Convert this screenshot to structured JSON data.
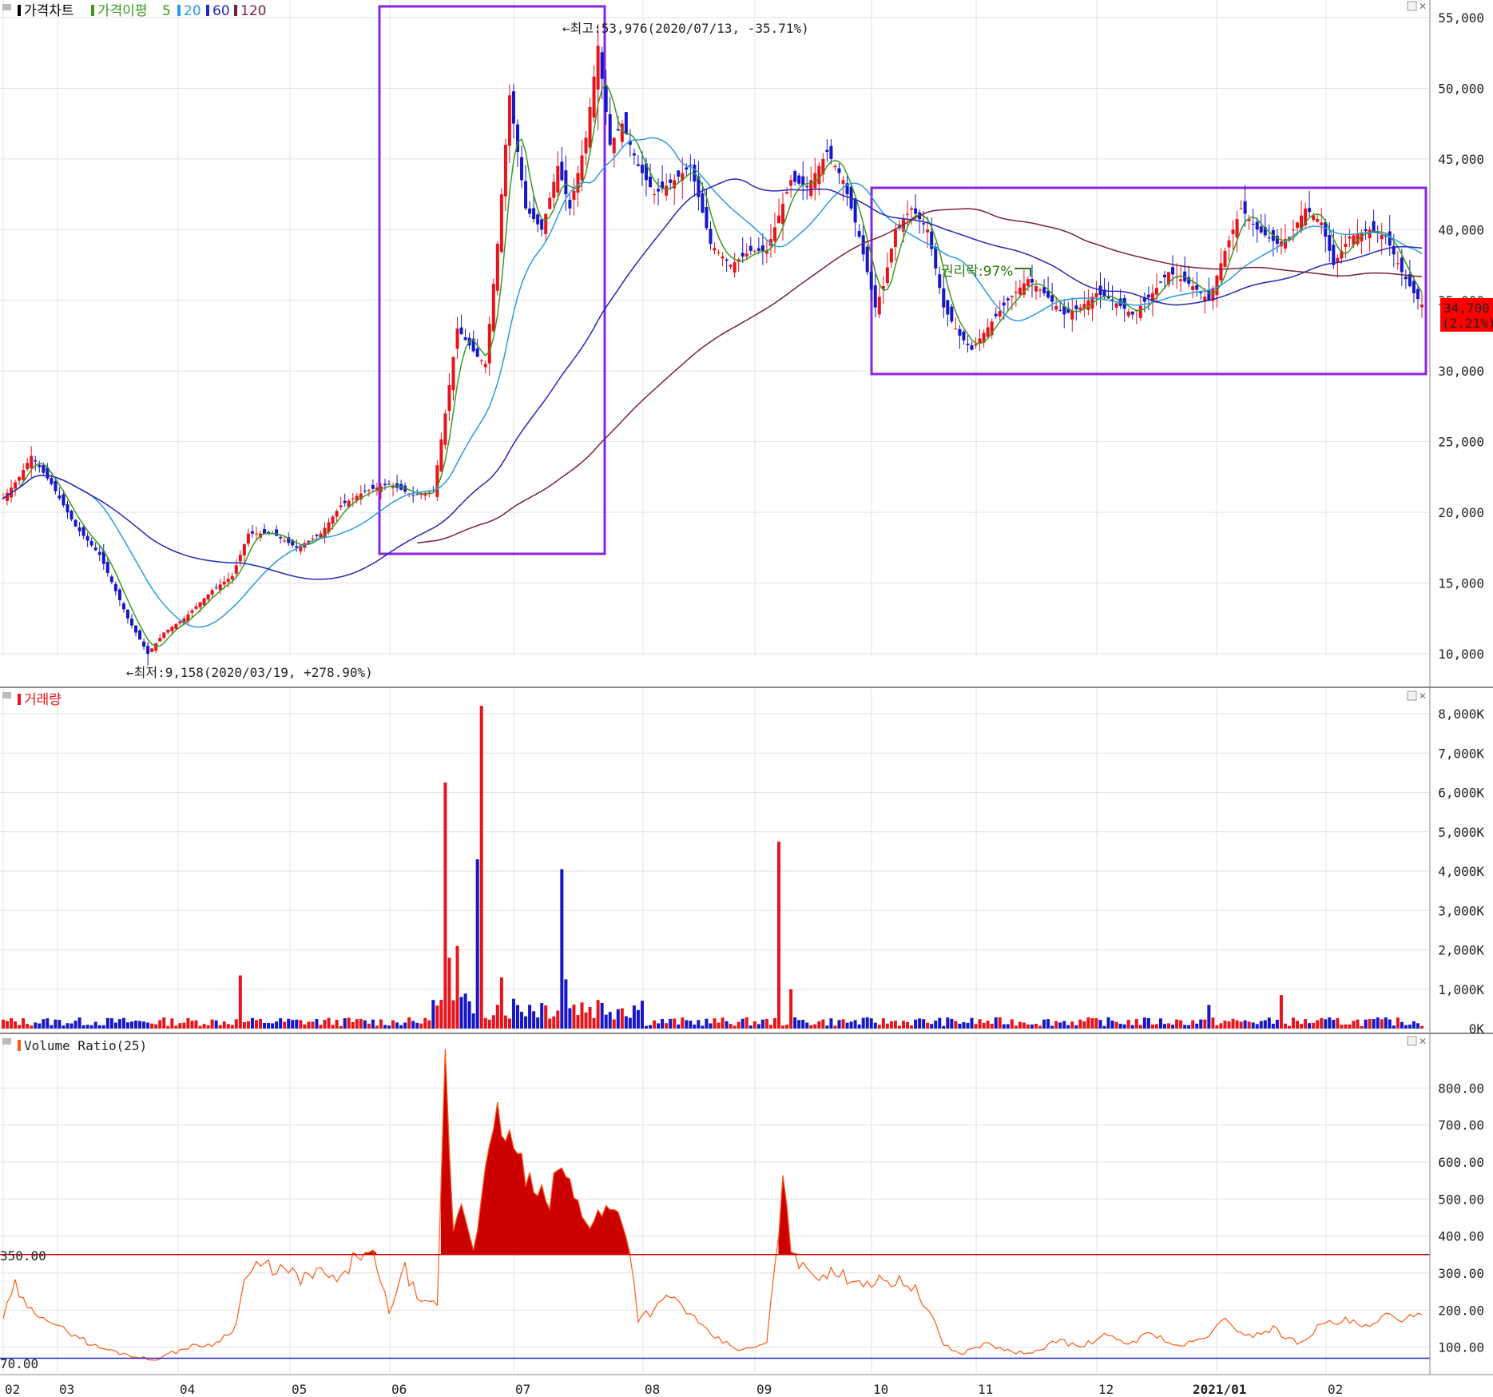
{
  "colors": {
    "up": "#e8141b",
    "down": "#1717c8",
    "ma5": "#3c9a1e",
    "ma20": "#2b9be0",
    "ma60": "#2626b8",
    "ma120": "#7a1f3c",
    "box": "#8a24e0",
    "ratio_line": "#ff5a14",
    "ratio_fill": "#cc0000",
    "label_box_bg": "#ff0000"
  },
  "price_panel": {
    "legend": [
      "가격차트",
      "가격이평",
      "5",
      "20",
      "60",
      "120"
    ],
    "y_ticks": [
      "55,000",
      "50,000",
      "45,000",
      "40,000",
      "35,000",
      "30,000",
      "25,000",
      "20,000",
      "15,000",
      "10,000"
    ],
    "high_annotation": "←최고:53,976(2020/07/13, -35.71%)",
    "low_annotation": "←최저:9,158(2020/03/19, +278.90%)",
    "ex_rights_annotation": "권리락:97%",
    "current_price": "34,700",
    "current_change": "(2.21%)"
  },
  "volume_panel": {
    "title": "거래량",
    "y_ticks": [
      "8,000K",
      "7,000K",
      "6,000K",
      "5,000K",
      "4,000K",
      "3,000K",
      "2,000K",
      "1,000K",
      "0K"
    ]
  },
  "ratio_panel": {
    "title": "Volume Ratio(25)",
    "y_ticks": [
      "800.00",
      "700.00",
      "600.00",
      "500.00",
      "400.00",
      "300.00",
      "200.00",
      "100.00"
    ],
    "upper_line_label": "350.00",
    "lower_line_label": "70.00"
  },
  "x_axis": {
    "labels": [
      "02",
      "03",
      "04",
      "05",
      "06",
      "07",
      "08",
      "09",
      "10",
      "11",
      "12",
      "2021/01",
      "02"
    ]
  },
  "chart_data": [
    {
      "type": "candlestick",
      "ylim": [
        8000,
        56000
      ],
      "moving_averages": [
        5,
        20,
        60,
        120
      ],
      "anchors": [
        [
          0,
          21000
        ],
        [
          4,
          22500
        ],
        [
          7,
          24000
        ],
        [
          12,
          22000
        ],
        [
          18,
          19000
        ],
        [
          24,
          17000
        ],
        [
          31,
          12500
        ],
        [
          36,
          10000
        ],
        [
          40,
          11500
        ],
        [
          45,
          12500
        ],
        [
          52,
          14500
        ],
        [
          57,
          15500
        ],
        [
          61,
          18500
        ],
        [
          67,
          18500
        ],
        [
          73,
          17500
        ],
        [
          79,
          18500
        ],
        [
          84,
          20500
        ],
        [
          90,
          21500
        ],
        [
          96,
          22000
        ],
        [
          102,
          21200
        ],
        [
          107,
          21500
        ],
        [
          110,
          27000
        ],
        [
          113,
          33000
        ],
        [
          118,
          31000
        ],
        [
          120,
          30500
        ],
        [
          123,
          39000
        ],
        [
          126,
          49500
        ],
        [
          130,
          41500
        ],
        [
          134,
          40000
        ],
        [
          138,
          44500
        ],
        [
          141,
          41500
        ],
        [
          145,
          46500
        ],
        [
          148,
          53000
        ],
        [
          151,
          46000
        ],
        [
          154,
          47500
        ],
        [
          158,
          44500
        ],
        [
          162,
          42500
        ],
        [
          167,
          43500
        ],
        [
          171,
          44500
        ],
        [
          176,
          39000
        ],
        [
          181,
          37500
        ],
        [
          186,
          38500
        ],
        [
          190,
          38500
        ],
        [
          196,
          43500
        ],
        [
          200,
          43000
        ],
        [
          205,
          45500
        ],
        [
          209,
          43500
        ],
        [
          213,
          39500
        ],
        [
          217,
          34500
        ],
        [
          219,
          36000
        ],
        [
          222,
          40000
        ],
        [
          226,
          41500
        ],
        [
          230,
          40000
        ],
        [
          234,
          34500
        ],
        [
          238,
          32500
        ],
        [
          241,
          31500
        ],
        [
          246,
          33500
        ],
        [
          250,
          35000
        ],
        [
          255,
          36500
        ],
        [
          259,
          35500
        ],
        [
          264,
          34000
        ],
        [
          268,
          34500
        ],
        [
          272,
          35500
        ],
        [
          276,
          35000
        ],
        [
          281,
          34000
        ],
        [
          286,
          35500
        ],
        [
          290,
          37000
        ],
        [
          296,
          36000
        ],
        [
          300,
          35000
        ],
        [
          304,
          38500
        ],
        [
          308,
          41500
        ],
        [
          312,
          40000
        ],
        [
          317,
          39000
        ],
        [
          320,
          39500
        ],
        [
          324,
          41500
        ],
        [
          328,
          40500
        ],
        [
          331,
          37500
        ],
        [
          335,
          39500
        ],
        [
          340,
          40000
        ],
        [
          344,
          39500
        ],
        [
          348,
          37000
        ],
        [
          351,
          35500
        ],
        [
          353,
          34700
        ]
      ],
      "low_value": 9158,
      "low_date": "2020/03/19",
      "high_value": 53976,
      "high_date": "2020/07/13",
      "last_close": 34700,
      "last_change_pct": 2.21
    },
    {
      "type": "bar",
      "series": "거래량",
      "ylim": [
        0,
        8200000
      ],
      "baseline_volume": 160000,
      "spikes": [
        [
          59,
          1350000
        ],
        [
          110,
          6250000
        ],
        [
          111,
          1800000
        ],
        [
          113,
          2100000
        ],
        [
          118,
          4300000
        ],
        [
          119,
          8200000
        ],
        [
          124,
          1300000
        ],
        [
          139,
          4050000
        ],
        [
          140,
          1250000
        ],
        [
          193,
          4750000
        ],
        [
          196,
          1000000
        ],
        [
          300,
          600000
        ],
        [
          318,
          850000
        ]
      ]
    },
    {
      "type": "area",
      "series": "Volume Ratio(25)",
      "ylim": [
        30,
        900
      ],
      "reference_lines": [
        350,
        70
      ],
      "anchors": [
        [
          0,
          180
        ],
        [
          3,
          265
        ],
        [
          6,
          200
        ],
        [
          10,
          190
        ],
        [
          14,
          150
        ],
        [
          18,
          135
        ],
        [
          22,
          105
        ],
        [
          27,
          90
        ],
        [
          33,
          75
        ],
        [
          37,
          65
        ],
        [
          41,
          80
        ],
        [
          46,
          100
        ],
        [
          53,
          110
        ],
        [
          58,
          160
        ],
        [
          60,
          285
        ],
        [
          64,
          320
        ],
        [
          69,
          310
        ],
        [
          74,
          285
        ],
        [
          79,
          300
        ],
        [
          84,
          275
        ],
        [
          88,
          355
        ],
        [
          92,
          340
        ],
        [
          96,
          200
        ],
        [
          100,
          310
        ],
        [
          104,
          210
        ],
        [
          108,
          220
        ],
        [
          110,
          870
        ],
        [
          112,
          420
        ],
        [
          114,
          490
        ],
        [
          117,
          380
        ],
        [
          120,
          560
        ],
        [
          123,
          720
        ],
        [
          128,
          620
        ],
        [
          132,
          510
        ],
        [
          136,
          500
        ],
        [
          139,
          600
        ],
        [
          142,
          500
        ],
        [
          146,
          440
        ],
        [
          150,
          470
        ],
        [
          154,
          460
        ],
        [
          156,
          350
        ],
        [
          158,
          180
        ],
        [
          162,
          200
        ],
        [
          166,
          240
        ],
        [
          170,
          200
        ],
        [
          174,
          150
        ],
        [
          178,
          120
        ],
        [
          184,
          90
        ],
        [
          190,
          110
        ],
        [
          194,
          530
        ],
        [
          196,
          380
        ],
        [
          199,
          310
        ],
        [
          203,
          300
        ],
        [
          210,
          290
        ],
        [
          216,
          275
        ],
        [
          222,
          280
        ],
        [
          226,
          270
        ],
        [
          230,
          200
        ],
        [
          234,
          110
        ],
        [
          238,
          80
        ],
        [
          244,
          110
        ],
        [
          250,
          90
        ],
        [
          256,
          80
        ],
        [
          262,
          120
        ],
        [
          268,
          100
        ],
        [
          274,
          130
        ],
        [
          280,
          110
        ],
        [
          286,
          140
        ],
        [
          292,
          100
        ],
        [
          298,
          120
        ],
        [
          304,
          170
        ],
        [
          310,
          130
        ],
        [
          316,
          150
        ],
        [
          322,
          110
        ],
        [
          328,
          160
        ],
        [
          334,
          170
        ],
        [
          340,
          150
        ],
        [
          345,
          190
        ],
        [
          349,
          175
        ],
        [
          353,
          180
        ]
      ]
    }
  ]
}
